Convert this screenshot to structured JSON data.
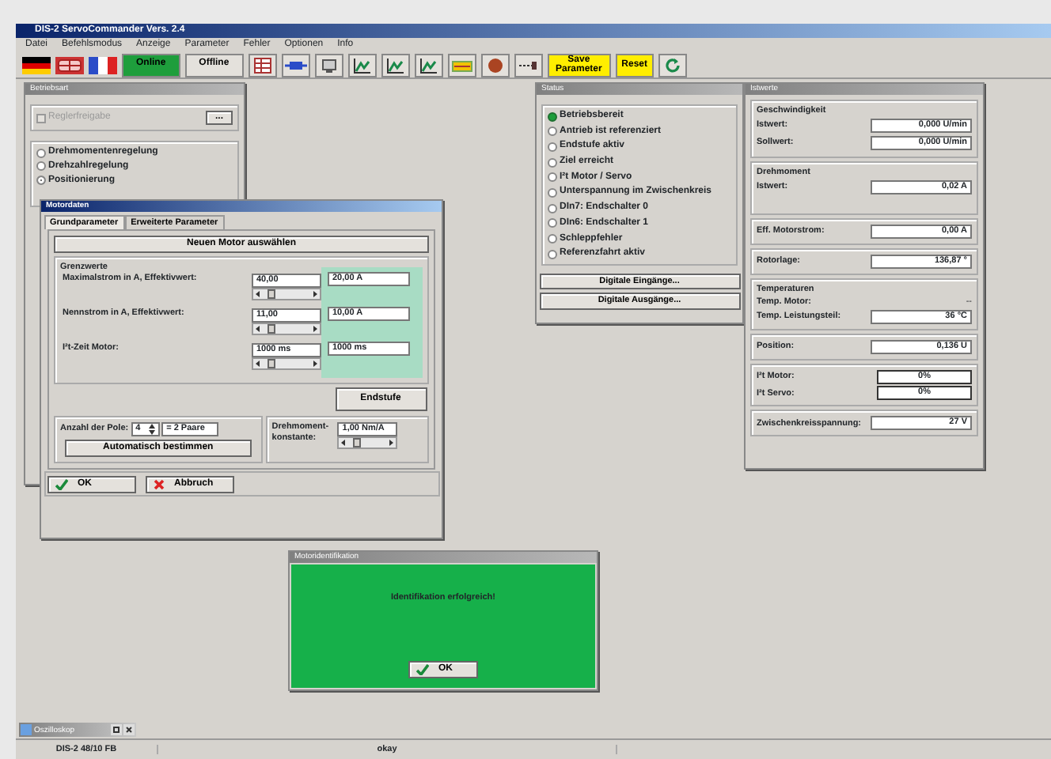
{
  "app": {
    "title": "DIS-2 ServoCommander Vers. 2.4"
  },
  "menu": [
    "Datei",
    "Befehlsmodus",
    "Anzeige",
    "Parameter",
    "Fehler",
    "Optionen",
    "Info"
  ],
  "connection": [
    {
      "label": "Online",
      "selected": true
    },
    {
      "label": "Offline",
      "selected": false
    }
  ],
  "actions": [
    "Save Parameter",
    "Reset"
  ],
  "modes_panel": {
    "title": "Betriebsart",
    "enable": {
      "label": "Reglerfreigabe",
      "checked": false,
      "disabled": true
    },
    "button": "...",
    "modes": [
      {
        "label": "Drehmomentenregelung",
        "selected": false
      },
      {
        "label": "Drehzahlregelung",
        "selected": false
      },
      {
        "label": "Positionierung",
        "selected": true
      }
    ]
  },
  "motor_dialog": {
    "title": "Motordaten",
    "tabs": [
      {
        "label": "Grundparameter",
        "selected": true
      },
      {
        "label": "Erweiterte Parameter",
        "selected": false
      }
    ],
    "select_button": "Neuen Motor auswählen",
    "group": "Grenzwerte",
    "rows": [
      {
        "label": "Maximalstrom in A, Effektivwert:",
        "value": "40,00",
        "level": 0.3,
        "reading": "20,00 A"
      },
      {
        "label": "Nennstrom in A, Effektivwert:",
        "value": "11,00",
        "level": 0.3,
        "reading": "10,00 A"
      },
      {
        "label": "I²t-Zeit Motor:",
        "value": "1000 ms",
        "level": 0.3,
        "reading": "1000 ms"
      }
    ],
    "stage_button": "Endstufe",
    "poles": {
      "label": "Anzahl der Pole:",
      "value": "4",
      "pairs": "= 2 Paare",
      "button": "Automatisch bestimmen"
    },
    "torque": {
      "label": "Drehmoment-konstante:",
      "value": "1,00 Nm/A",
      "level": 0.35
    },
    "buttons": [
      {
        "label": "OK",
        "kind": "ok"
      },
      {
        "label": "Abbruch",
        "kind": "cancel"
      }
    ]
  },
  "status": {
    "title": "Status",
    "items": [
      {
        "label": "Betriebsbereit",
        "on": true
      },
      {
        "label": "Antrieb ist referenziert",
        "on": false
      },
      {
        "label": "Endstufe aktiv",
        "on": false
      },
      {
        "label": "Ziel erreicht",
        "on": false
      },
      {
        "label": "I²t Motor / Servo",
        "on": false
      },
      {
        "label": "Unterspannung im Zwischenkreis",
        "on": false
      },
      {
        "label": "DIn7: Endschalter 0",
        "on": false
      },
      {
        "label": "DIn6: Endschalter 1",
        "on": false
      },
      {
        "label": "Schleppfehler",
        "on": false
      },
      {
        "label": "Referenzfahrt aktiv",
        "on": false
      }
    ],
    "buttons": [
      "Digitale Eingänge...",
      "Digitale Ausgänge..."
    ]
  },
  "actual_values": {
    "title": "Istwerte",
    "sections": [
      {
        "title": "Geschwindigkeit",
        "rows": [
          {
            "kind": "field",
            "label": "Istwert:",
            "value": "0,000 U/min"
          },
          {
            "kind": "field",
            "label": "Sollwert:",
            "value": "0,000 U/min"
          }
        ]
      },
      {
        "title": "Drehmoment",
        "rows": [
          {
            "kind": "field",
            "label": "Istwert:",
            "value": "0,02 A"
          }
        ]
      },
      {
        "rows": [
          {
            "kind": "field",
            "label": "Eff. Motorstrom:",
            "value": "0,00 A"
          }
        ]
      },
      {
        "rows": [
          {
            "kind": "field",
            "label": "Rotorlage:",
            "value": "136,87 °"
          }
        ]
      },
      {
        "title": "Temperaturen",
        "rows": [
          {
            "kind": "plain",
            "label": "Temp. Motor:",
            "value": "--"
          },
          {
            "kind": "field",
            "label": "Temp. Leistungsteil:",
            "value": "36 °C"
          }
        ]
      },
      {
        "rows": [
          {
            "kind": "field",
            "label": "Position:",
            "value": "0,136 U"
          }
        ]
      },
      {
        "rows": [
          {
            "kind": "bar",
            "label": "I²t Motor:",
            "value": "0%"
          },
          {
            "kind": "bar",
            "label": "I²t Servo:",
            "value": "0%"
          }
        ]
      },
      {
        "rows": [
          {
            "kind": "field",
            "label": "Zwischenkreisspannung:",
            "value": "27 V"
          }
        ]
      }
    ]
  },
  "ident_dialog": {
    "title": "Motoridentifikation",
    "message": "Identifikation erfolgreich!",
    "button": "OK"
  },
  "minimized": {
    "title": "Oszilloskop"
  },
  "status_bar": [
    "DIS-2 48/10 FB",
    "okay"
  ]
}
